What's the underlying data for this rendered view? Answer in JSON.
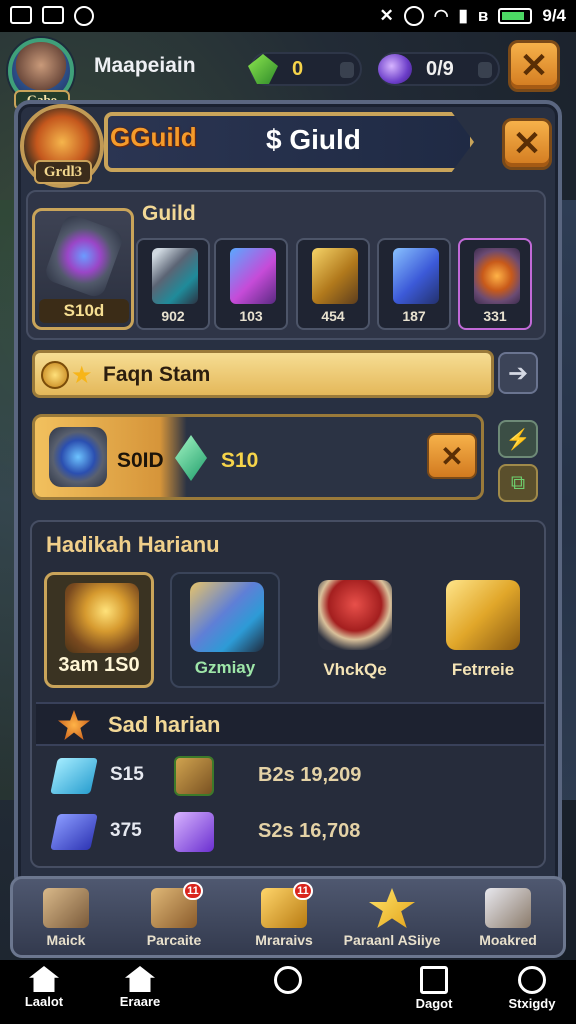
{
  "status_bar": {
    "time": "9/4"
  },
  "header": {
    "avatar_label": "Gabo",
    "player_name": "Maapeiain",
    "resource_green": "0",
    "resource_purple": "0/9"
  },
  "guild": {
    "emblem_label": "Grdl3",
    "banner_left": "GGuild",
    "banner_right": "$ Giuld"
  },
  "inventory": {
    "title": "Guild",
    "main_item_count": "S10d",
    "slots": [
      {
        "count": "902",
        "icon": "spear-icon"
      },
      {
        "count": "103",
        "icon": "crystal-axe-icon"
      },
      {
        "count": "454",
        "icon": "golden-blade-icon"
      },
      {
        "count": "187",
        "icon": "blue-dagger-icon"
      },
      {
        "count": "331",
        "icon": "emblem-shield-icon"
      }
    ]
  },
  "gold_bar": {
    "label": "Faqn Stam"
  },
  "gold_item": {
    "label": "S0ID",
    "value": "S10"
  },
  "daily": {
    "title": "Hadikah Harianu",
    "rewards": [
      {
        "caption": "3am 1S0",
        "icon": "treasure-chest-icon"
      },
      {
        "caption": "Gzmiay",
        "icon": "blue-sword-icon"
      },
      {
        "caption": "VhckQe",
        "icon": "red-mushroom-icon"
      },
      {
        "caption": "Fetrreie",
        "icon": "gold-box-icon"
      }
    ],
    "sub_header": "Sad harian",
    "rows": [
      {
        "num": "S15",
        "amount": "B2s 19,209",
        "gem_color": "#5fd0f5",
        "box": "wood-crate-icon"
      },
      {
        "num": "375",
        "amount": "S2s 16,708",
        "gem_color": "#4a5de0",
        "box": "purple-cube-icon"
      }
    ]
  },
  "game_nav": [
    {
      "label": "Maick",
      "badge": "",
      "icon": "scroll-icon"
    },
    {
      "label": "Parcaite",
      "badge": "11",
      "icon": "crate-icon"
    },
    {
      "label": "Mraraivs",
      "badge": "11",
      "icon": "gold-chest-icon"
    },
    {
      "label": "Paraanl ASiiye",
      "badge": "",
      "icon": "star-icon"
    },
    {
      "label": "Moakred",
      "badge": "",
      "icon": "scroll-box-icon"
    }
  ],
  "system_nav": [
    {
      "label": "Laalot",
      "icon": "home-icon"
    },
    {
      "label": "Eraare",
      "icon": "home-icon"
    },
    {
      "label": "",
      "icon": "circle-icon"
    },
    {
      "label": "Dagot",
      "icon": "square-icon"
    },
    {
      "label": "Stxigdy",
      "icon": "circle-icon"
    }
  ],
  "colors": {
    "accent_orange": "#e48b27",
    "panel": "#283042",
    "gold": "#c9a45a"
  }
}
